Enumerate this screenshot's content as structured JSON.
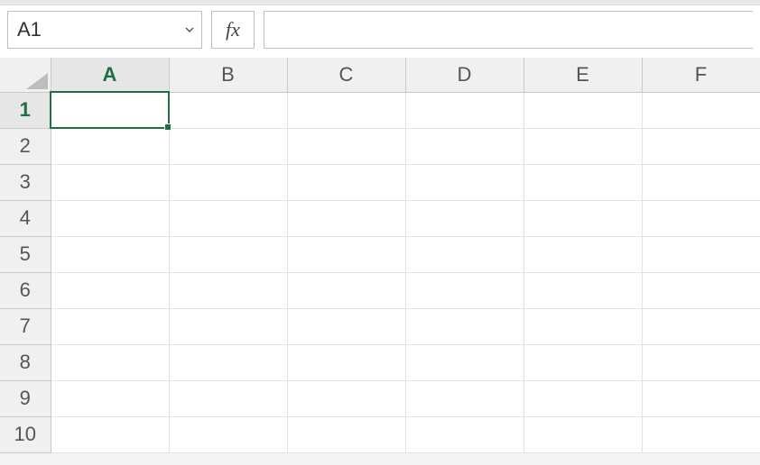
{
  "colors": {
    "accent": "#1e6f42",
    "grid_line": "#e3e3e3",
    "header_bg": "#f0f0f0",
    "header_border": "#c8c8c8"
  },
  "formula_bar": {
    "name_box_value": "A1",
    "fx_label": "fx",
    "formula_value": ""
  },
  "sheet": {
    "columns": [
      "A",
      "B",
      "C",
      "D",
      "E",
      "F"
    ],
    "rows": [
      "1",
      "2",
      "3",
      "4",
      "5",
      "6",
      "7",
      "8",
      "9",
      "10"
    ],
    "active_cell": {
      "col": "A",
      "row": "1"
    },
    "cells": {}
  }
}
